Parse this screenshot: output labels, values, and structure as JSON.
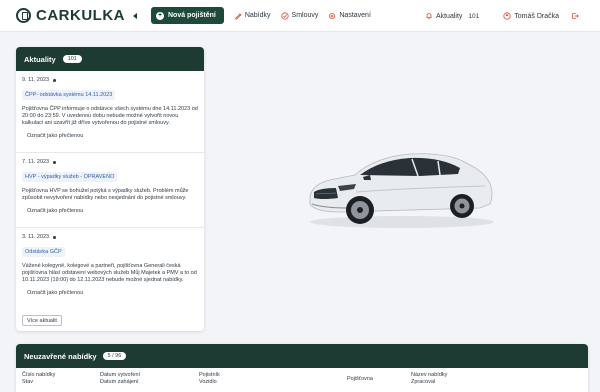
{
  "brand": {
    "name": "CARKULKA"
  },
  "nav": {
    "new_offer": "Nová pojištění",
    "offers": "Nabídky",
    "contracts": "Smlouvy",
    "settings": "Nastavení",
    "news": "Aktuality",
    "news_count": "101",
    "user": "Tomáš Dračka"
  },
  "news": {
    "title": "Aktuality",
    "count": "101",
    "items": [
      {
        "date": "9. 11. 2023",
        "tag": "ČPP- odstávka systému 14.11.2023",
        "body": "Pojišťovna ČPP informuje o odstávce všech systému dne 14.11.2023 od 20:00 do 23:59. V uvedenou dobu nebude možné vytvořit novou kalkulaci ani uzavřít již dříve vytvořenou do pojistné smlouvy.",
        "mark": "Označit jako přečtenou"
      },
      {
        "date": "7. 11. 2023",
        "tag": "HVP - výpadky služeb - OPRAVENO",
        "body": "Pojišťovna HVP se bohužel potýká s výpadky služeb. Problém může způsobit nevytvoření nabídky nebo nesjednání do pojistné smlouvy.",
        "mark": "Označit jako přečtenou"
      },
      {
        "date": "3. 11. 2023",
        "tag": "Odstávka GČP",
        "body": "Vážené kolegyně, kolegové a partneři, pojišťovna Generali česká pojišťovna hlásí odstavení webových služeb Můj Majetek a PMV a to od 10.11.2023 (19:00) do 12.11.2023 nebude možné sjednat nabídky.",
        "mark": "Označit jako přečtenou"
      }
    ],
    "more": "Více aktualit"
  },
  "offers": {
    "title": "Neuzavřené nabídky",
    "count": "5 / 96",
    "columns": [
      {
        "line1": "Číslo nabídky",
        "line2": "Stav"
      },
      {
        "line1": "Datum vytvoření",
        "line2": "Datum zahájení"
      },
      {
        "line1": "Pojistník",
        "line2": "Vozidlo"
      },
      {
        "line1": "Pojišťovna",
        "line2": ""
      },
      {
        "line1": "Název nabídky",
        "line2": "Zpracoval"
      }
    ]
  },
  "colors": {
    "brand": "#1d3b33",
    "accent_red": "#e2452d",
    "button": "#1d4a3c"
  }
}
